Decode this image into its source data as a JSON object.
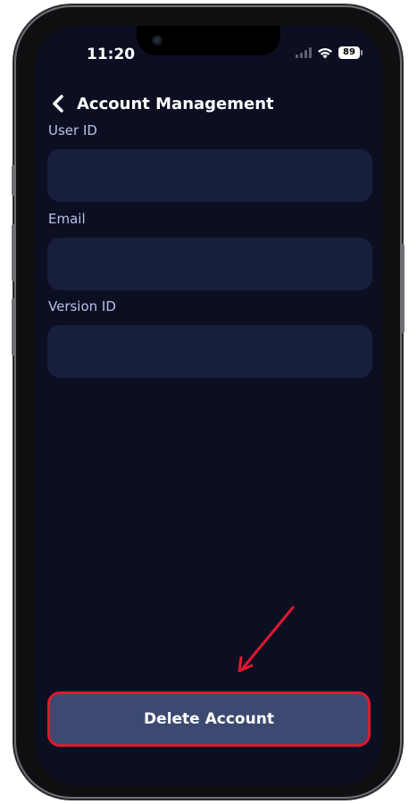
{
  "status_bar": {
    "time": "11:20",
    "battery": "89"
  },
  "header": {
    "back_icon": "chevron-left-icon",
    "title": "Account Management"
  },
  "fields": [
    {
      "label": "User ID",
      "value": ""
    },
    {
      "label": "Email",
      "value": ""
    },
    {
      "label": "Version ID",
      "value": ""
    }
  ],
  "actions": {
    "delete_label": "Delete Account"
  },
  "colors": {
    "screen_bg": "#0c0f22",
    "field_bg": "#181f3c",
    "label": "#b7c2eb",
    "button_bg": "#3c4a72",
    "highlight": "#e01830"
  }
}
